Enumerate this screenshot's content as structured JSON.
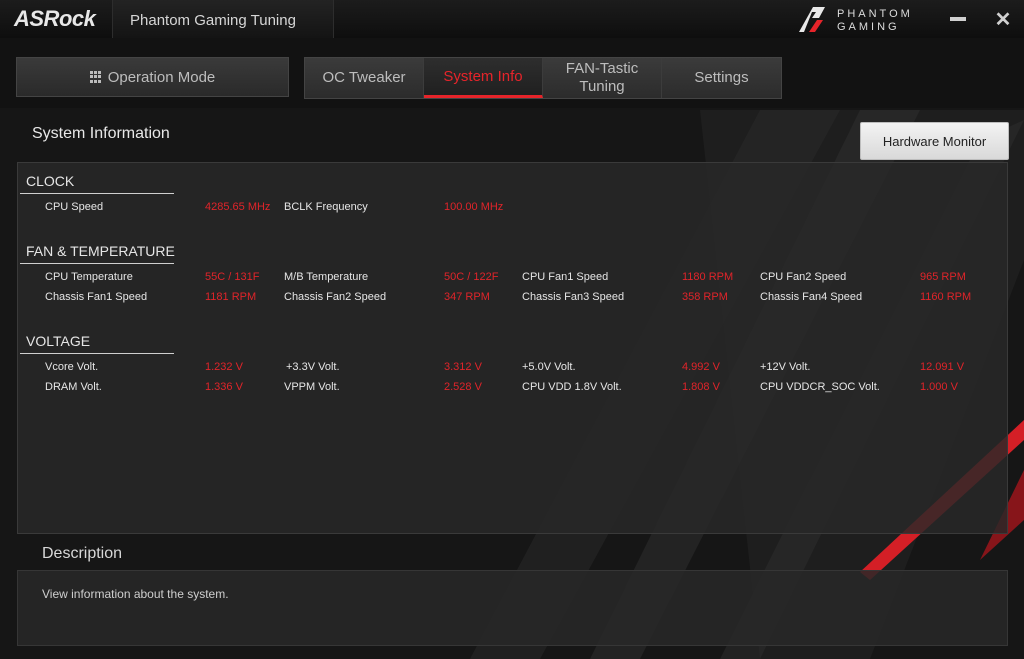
{
  "window": {
    "brand": "ASRock",
    "app_title": "Phantom Gaming Tuning",
    "pg_logo_line1": "PHANTOM",
    "pg_logo_line2": "GAMING",
    "minimize_icon": "minimize-icon",
    "close_icon": "close-icon"
  },
  "nav": {
    "operation_mode": "Operation Mode",
    "tabs": [
      {
        "label": "OC Tweaker",
        "active": false
      },
      {
        "label": "System Info",
        "active": true
      },
      {
        "label": "FAN-Tastic Tuning",
        "active": false
      },
      {
        "label": "Settings",
        "active": false
      }
    ]
  },
  "section": {
    "title": "System Information",
    "hardware_monitor_button": "Hardware Monitor"
  },
  "groups": {
    "clock": {
      "label": "CLOCK",
      "rows": [
        [
          {
            "label": "CPU Speed",
            "value": "4285.65 MHz"
          },
          {
            "label": "BCLK Frequency",
            "value": "100.00 MHz"
          }
        ]
      ]
    },
    "fan_temp": {
      "label": "FAN & TEMPERATURE",
      "rows": [
        [
          {
            "label": "CPU Temperature",
            "value": "55C / 131F"
          },
          {
            "label": "M/B Temperature",
            "value": "50C / 122F"
          },
          {
            "label": "CPU Fan1 Speed",
            "value": "1180 RPM"
          },
          {
            "label": "CPU Fan2 Speed",
            "value": "965 RPM"
          }
        ],
        [
          {
            "label": "Chassis Fan1 Speed",
            "value": "1181 RPM"
          },
          {
            "label": "Chassis Fan2 Speed",
            "value": "347 RPM"
          },
          {
            "label": "Chassis Fan3 Speed",
            "value": "358 RPM"
          },
          {
            "label": "Chassis Fan4 Speed",
            "value": "1160 RPM"
          }
        ]
      ]
    },
    "voltage": {
      "label": "VOLTAGE",
      "rows": [
        [
          {
            "label": "Vcore Volt.",
            "value": "1.232 V"
          },
          {
            "label": "+3.3V Volt.",
            "value": "3.312 V"
          },
          {
            "label": "+5.0V Volt.",
            "value": "4.992 V"
          },
          {
            "label": "+12V Volt.",
            "value": "12.091 V"
          }
        ],
        [
          {
            "label": "DRAM Volt.",
            "value": "1.336 V"
          },
          {
            "label": "VPPM Volt.",
            "value": "2.528 V"
          },
          {
            "label": "CPU VDD 1.8V Volt.",
            "value": "1.808 V"
          },
          {
            "label": "CPU VDDCR_SOC Volt.",
            "value": "1.000 V"
          }
        ]
      ]
    }
  },
  "description": {
    "title": "Description",
    "text": "View information about the system."
  },
  "colors": {
    "accent": "#e6242a",
    "background": "#161616",
    "panel": "#282828"
  }
}
